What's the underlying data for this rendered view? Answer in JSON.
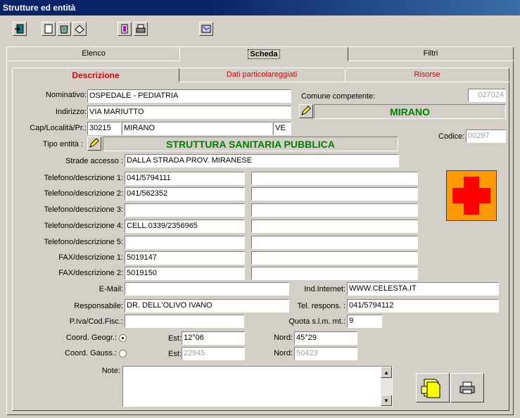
{
  "window": {
    "title": "Strutture ed entità"
  },
  "toolbar": {
    "buttons": [
      "exit-icon",
      "new-doc-icon",
      "recycle-icon",
      "erase-icon",
      "copy-icon",
      "print-icon",
      "map-icon"
    ]
  },
  "tabs_main": [
    {
      "label": "Elenco"
    },
    {
      "label": "Scheda"
    },
    {
      "label": "Filtri"
    }
  ],
  "tabs_sub": [
    {
      "label": "Descrizione"
    },
    {
      "label": "Dati particolareggiati"
    },
    {
      "label": "Risorse"
    }
  ],
  "form": {
    "nominativo": {
      "label": "Nominativo:",
      "value": "OSPEDALE - PEDIATRIA"
    },
    "indirizzo": {
      "label": "Indirizzo:",
      "value": "VIA MARIUTTO"
    },
    "cap": {
      "label": "Cap/Località/Pr.:",
      "cap": "30215",
      "localita": "MIRANO",
      "provincia": "VE"
    },
    "tipo": {
      "label": "Tipo entità :",
      "value": "STRUTTURA SANITARIA PUBBLICA"
    },
    "strade": {
      "label": "Strade accesso :",
      "value": "DALLA STRADA PROV. MIRANESE"
    },
    "comune": {
      "label": "Comune competente:",
      "code": "027024",
      "name": "MIRANO"
    },
    "codice": {
      "label": "Codice:",
      "value": "00297"
    },
    "phones": [
      {
        "label": "Telefono/descrizione 1:",
        "value": "041/5794111",
        "desc": ""
      },
      {
        "label": "Telefono/descrizione 2:",
        "value": "041/562352",
        "desc": ""
      },
      {
        "label": "Telefono/descrizione 3:",
        "value": "",
        "desc": ""
      },
      {
        "label": "Telefono/descrizione 4:",
        "value": "CELL.0339/2356965",
        "desc": ""
      },
      {
        "label": "Telefono/descrizione 5:",
        "value": "",
        "desc": ""
      },
      {
        "label": "FAX/descrizione 1:",
        "value": "5019147",
        "desc": ""
      },
      {
        "label": "FAX/descrizione 2:",
        "value": "5019150",
        "desc": ""
      }
    ],
    "email": {
      "label": "E-Mail:",
      "value": ""
    },
    "internet": {
      "label": "Ind.Internet:",
      "value": "WWW.CELESTA.IT"
    },
    "responsabile": {
      "label": "Responsabile:",
      "value": "DR. DELL'OLIVO IVANO"
    },
    "tel_respons": {
      "label": "Tel. respons. :",
      "value": "041/5794112"
    },
    "piva": {
      "label": "P.Iva/Cod.Fisc.:",
      "value": ""
    },
    "quota": {
      "label": "Quota s.l.m. mt.:",
      "value": "9"
    },
    "coord_geogr": {
      "label": "Coord. Geogr.:",
      "est_label": "Est:",
      "est": "12°06",
      "nord_label": "Nord:",
      "nord": "45°29"
    },
    "coord_gauss": {
      "label": "Coord. Gauss.:",
      "est_label": "Est:",
      "est": "22945",
      "nord_label": "Nord:",
      "nord": "50423"
    },
    "note": {
      "label": "Note:",
      "value": ""
    }
  },
  "colors": {
    "cross_red": "#ff0000",
    "cross_bg": "#ff9900",
    "banner_green": "#008000",
    "active_tab_red": "#e00000"
  }
}
